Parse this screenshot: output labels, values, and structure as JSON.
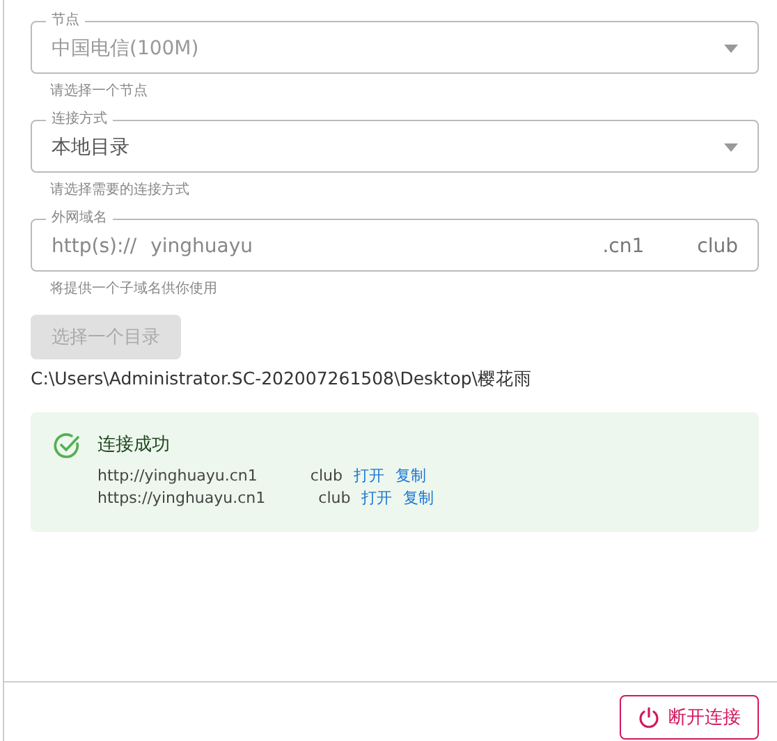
{
  "fields": [
    {
      "kind": "select",
      "label": "节点",
      "value": "中国电信(100M)",
      "hint": "请选择一个节点",
      "disabled": true
    },
    {
      "kind": "select",
      "label": "连接方式",
      "value": "本地目录",
      "hint": "请选择需要的连接方式",
      "disabled": false
    },
    {
      "kind": "domain",
      "label": "外网域名",
      "prefix": "http(s)://",
      "value": "yinghuayu",
      "suffix": ".cn1",
      "suffix_end": "club",
      "hint": "将提供一个子域名供你使用"
    }
  ],
  "choose_button": {
    "label": "选择一个目录",
    "disabled": true
  },
  "path": "C:\\Users\\Administrator.SC-202007261508\\Desktop\\樱花雨",
  "alert": {
    "title": "连接成功",
    "links": [
      {
        "url_start": "http://yinghuayu.cn1",
        "url_end": "club",
        "open": "打开",
        "copy": "复制"
      },
      {
        "url_start": "https://yinghuayu.cn1",
        "url_end": "club",
        "open": "打开",
        "copy": "复制"
      }
    ]
  },
  "disconnect_button": {
    "label": "断开连接"
  }
}
